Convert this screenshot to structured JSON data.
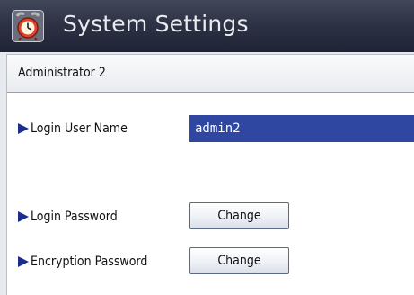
{
  "window": {
    "title": "System Settings",
    "icon": "alarm-clock-icon"
  },
  "section": {
    "title": "Administrator 2"
  },
  "fields": {
    "login_user_name": {
      "label": "Login User Name",
      "value": "admin2"
    },
    "login_password": {
      "label": "Login Password",
      "button_label": "Change"
    },
    "encryption_password": {
      "label": "Encryption Password",
      "button_label": "Change"
    }
  },
  "colors": {
    "titlebar": "#2e3245",
    "arrow": "#1b2d8f",
    "field_bg": "#2f47a0"
  }
}
